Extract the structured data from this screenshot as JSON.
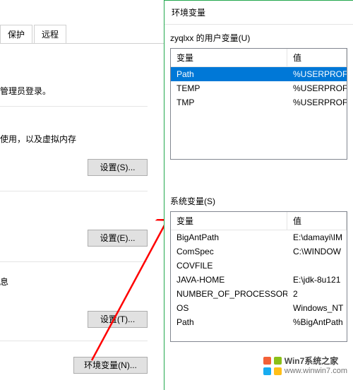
{
  "bg": {
    "tabs": {
      "protect": "保护",
      "remote": "远程"
    },
    "line1": "管理员登录。",
    "line2": "使用，以及虚拟内存",
    "btn_s": "设置(S)...",
    "btn_e": "设置(E)...",
    "label_info": "息",
    "btn_t": "设置(T)...",
    "btn_env": "环境变量(N)..."
  },
  "dialog": {
    "title": "环境变量",
    "user_group": "zyqlxx 的用户变量(U)",
    "sys_group": "系统变量(S)",
    "col_var": "变量",
    "col_val": "值",
    "user_vars": [
      {
        "name": "Path",
        "value": "%USERPROF"
      },
      {
        "name": "TEMP",
        "value": "%USERPROF"
      },
      {
        "name": "TMP",
        "value": "%USERPROF"
      }
    ],
    "sys_vars": [
      {
        "name": "BigAntPath",
        "value": "E:\\damayi\\IM"
      },
      {
        "name": "ComSpec",
        "value": "C:\\WINDOW"
      },
      {
        "name": "COVFILE",
        "value": ""
      },
      {
        "name": "JAVA-HOME",
        "value": "E:\\jdk-8u121"
      },
      {
        "name": "NUMBER_OF_PROCESSORS",
        "value": "2"
      },
      {
        "name": "OS",
        "value": "Windows_NT"
      },
      {
        "name": "Path",
        "value": "%BigAntPath"
      }
    ]
  },
  "watermark": {
    "line1": "Win7系统之家",
    "line2": "www.winwin7.com"
  }
}
